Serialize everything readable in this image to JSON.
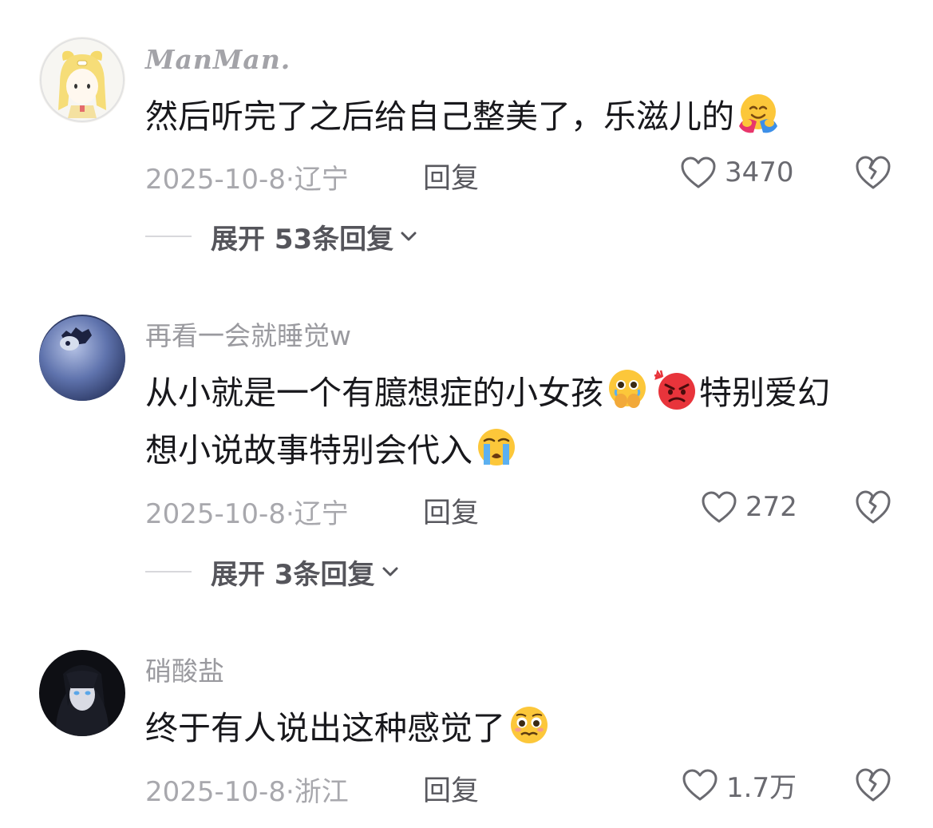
{
  "comments": [
    {
      "username": "ManMan.",
      "text": "然后听完了之后给自己整美了，乐滋儿的",
      "emojis": [
        "hugging-face-emoji"
      ],
      "date_location": "2025-10-8·辽宁",
      "reply_label": "回复",
      "likes": "3470",
      "expand_label": "展开 53条回复"
    },
    {
      "username": "再看一会就睡觉w",
      "text_line1": "从小就是一个有臆想症的小女孩",
      "text_line2": "想小说故事特别会代入",
      "text_mid": "特别爱幻",
      "emojis": [
        "holding-back-tears-emoji",
        "angry-face-emoji",
        "loudly-crying-emoji"
      ],
      "date_location": "2025-10-8·辽宁",
      "reply_label": "回复",
      "likes": "272",
      "expand_label": "展开 3条回复"
    },
    {
      "username": "硝酸盐",
      "text": "终于有人说出这种感觉了",
      "emojis": [
        "pleading-face-emoji"
      ],
      "date_location": "2025-10-8·浙江",
      "reply_label": "回复",
      "likes": "1.7万"
    }
  ],
  "colors": {
    "username": "#9a9a9f",
    "text": "#18181c",
    "meta": "#a8a8ad",
    "reply": "#58585e"
  }
}
